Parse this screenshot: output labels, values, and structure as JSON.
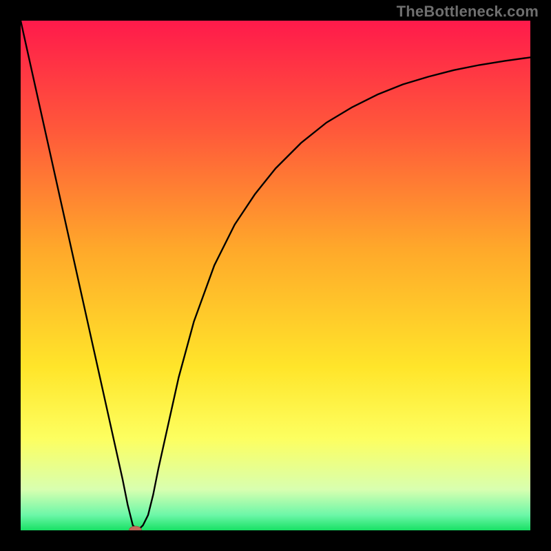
{
  "watermark": "TheBottleneck.com",
  "chart_data": {
    "type": "line",
    "title": "",
    "xlabel": "",
    "ylabel": "",
    "xlim": [
      0,
      100
    ],
    "ylim": [
      0,
      100
    ],
    "background_gradient": {
      "stops": [
        {
          "pct": 0,
          "color": "#ff1a4b"
        },
        {
          "pct": 22,
          "color": "#ff5a3a"
        },
        {
          "pct": 45,
          "color": "#ffa92a"
        },
        {
          "pct": 68,
          "color": "#ffe52a"
        },
        {
          "pct": 82,
          "color": "#fdff60"
        },
        {
          "pct": 92,
          "color": "#d8ffb0"
        },
        {
          "pct": 97,
          "color": "#6cf7a8"
        },
        {
          "pct": 100,
          "color": "#18e164"
        }
      ]
    },
    "series": [
      {
        "name": "bottleneck-curve",
        "x": [
          0,
          2,
          4,
          6,
          8,
          10,
          12,
          14,
          16,
          18,
          20,
          21,
          22,
          23,
          24,
          25,
          26,
          27,
          29,
          31,
          34,
          38,
          42,
          46,
          50,
          55,
          60,
          65,
          70,
          75,
          80,
          85,
          90,
          95,
          100
        ],
        "y": [
          100,
          91,
          82,
          73,
          64,
          55,
          46,
          37,
          28,
          19,
          10,
          5,
          1,
          0,
          1,
          3,
          7,
          12,
          21,
          30,
          41,
          52,
          60,
          66,
          71,
          76,
          80,
          83,
          85.5,
          87.5,
          89,
          90.3,
          91.3,
          92.1,
          92.8
        ]
      }
    ],
    "annotations": [
      {
        "type": "marker",
        "shape": "ellipse",
        "x": 22.5,
        "y": 0,
        "color": "#c46a5a"
      }
    ]
  }
}
